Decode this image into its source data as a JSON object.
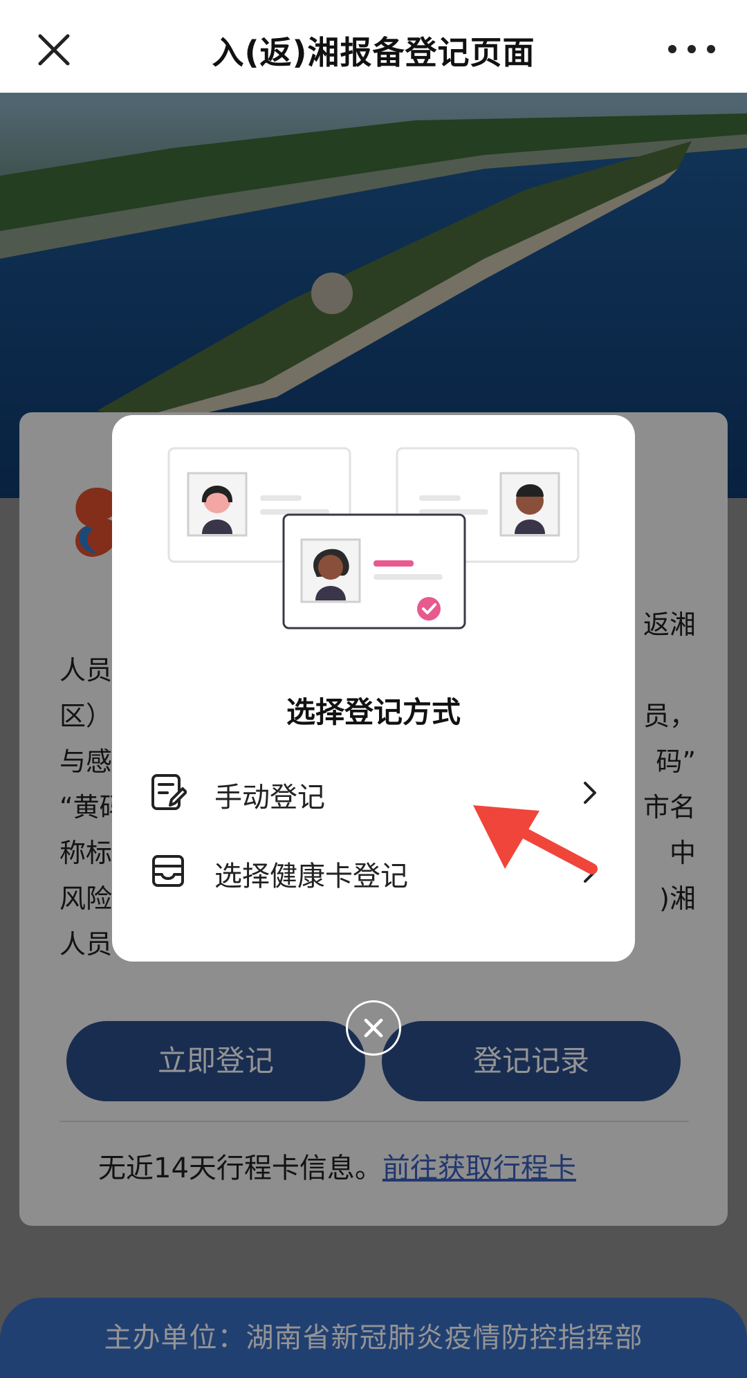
{
  "nav": {
    "title": "入(返)湘报备登记页面"
  },
  "card": {
    "paragraph_fragments": {
      "line1_right": "返湘",
      "line2_left": "人员",
      "line3_left": "区）",
      "line3_right": "员，",
      "line4_left": "与感",
      "line4_right": "码”",
      "line5_left": "“黄码",
      "line5_right": "市名",
      "line6_left": "称标",
      "line6_right": "中",
      "line7_left": "风险",
      "line7_right": ")湘",
      "line8_left": "人员"
    },
    "register_button": "立即登记",
    "records_button": "登记记录",
    "trip_text": "无近14天行程卡信息。",
    "trip_link": "前往获取行程卡"
  },
  "footer": {
    "text": "主办单位：湖南省新冠肺炎疫情防控指挥部"
  },
  "modal": {
    "title": "选择登记方式",
    "options": [
      {
        "label": "手动登记",
        "icon": "edit-document-icon"
      },
      {
        "label": "选择健康卡登记",
        "icon": "card-icon"
      }
    ],
    "accent_color": "#e8598e"
  },
  "colors": {
    "primary_button": "#2c4f8c",
    "footer": "#3a6ec4",
    "link": "#3b5fbf",
    "arrow": "#f0453a"
  }
}
